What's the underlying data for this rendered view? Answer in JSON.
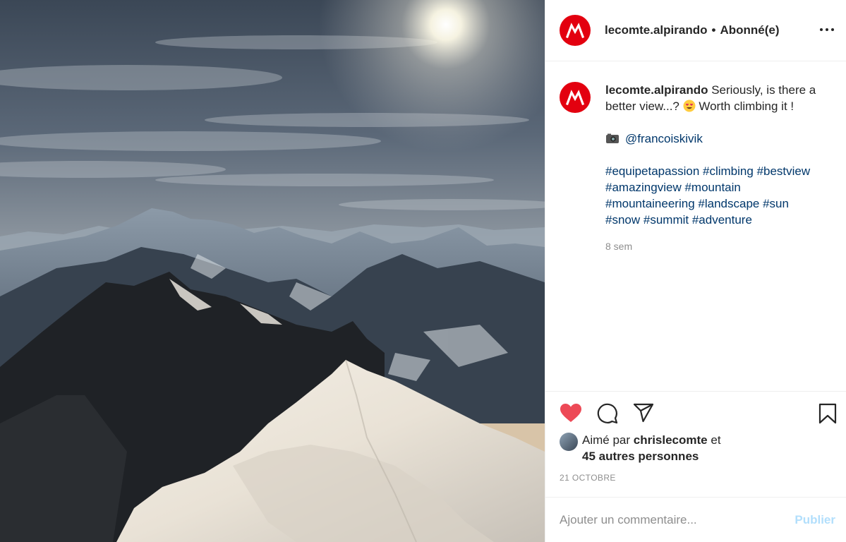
{
  "post": {
    "username": "lecomte.alpirando",
    "follow_status": "Abonné(e)",
    "separator": "•",
    "photo_alt": "Snowy mountain ridge under a bright sun"
  },
  "caption": {
    "username": "lecomte.alpirando",
    "text_1": " Seriously, is there a",
    "text_2": "better view...? ",
    "text_3": "  Worth climbing it !",
    "emoji_icon": "heart-eyes-emoji-icon",
    "mention": "@francoiskivik",
    "camera_icon": "camera-icon",
    "hashtag_lines": [
      [
        "#equipetapassion",
        "#climbing",
        "#bestview"
      ],
      [
        "#amazingview",
        "#mountain"
      ],
      [
        "#mountaineering",
        "#landscape",
        "#sun"
      ],
      [
        "#snow",
        "#summit",
        "#adventure"
      ]
    ],
    "time": "8 sem"
  },
  "likes": {
    "prefix": "Aimé par ",
    "liker": "chrislecomte",
    "middle": " et",
    "others": "45 autres personnes"
  },
  "date": "21 OCTOBRE",
  "comment_box": {
    "placeholder": "Ajouter un commentaire...",
    "publish_label": "Publier"
  },
  "colors": {
    "brand_red": "#e3000f",
    "like_red": "#ed4956",
    "link_blue": "#00376b",
    "publish_disabled": "#b2dffc"
  }
}
